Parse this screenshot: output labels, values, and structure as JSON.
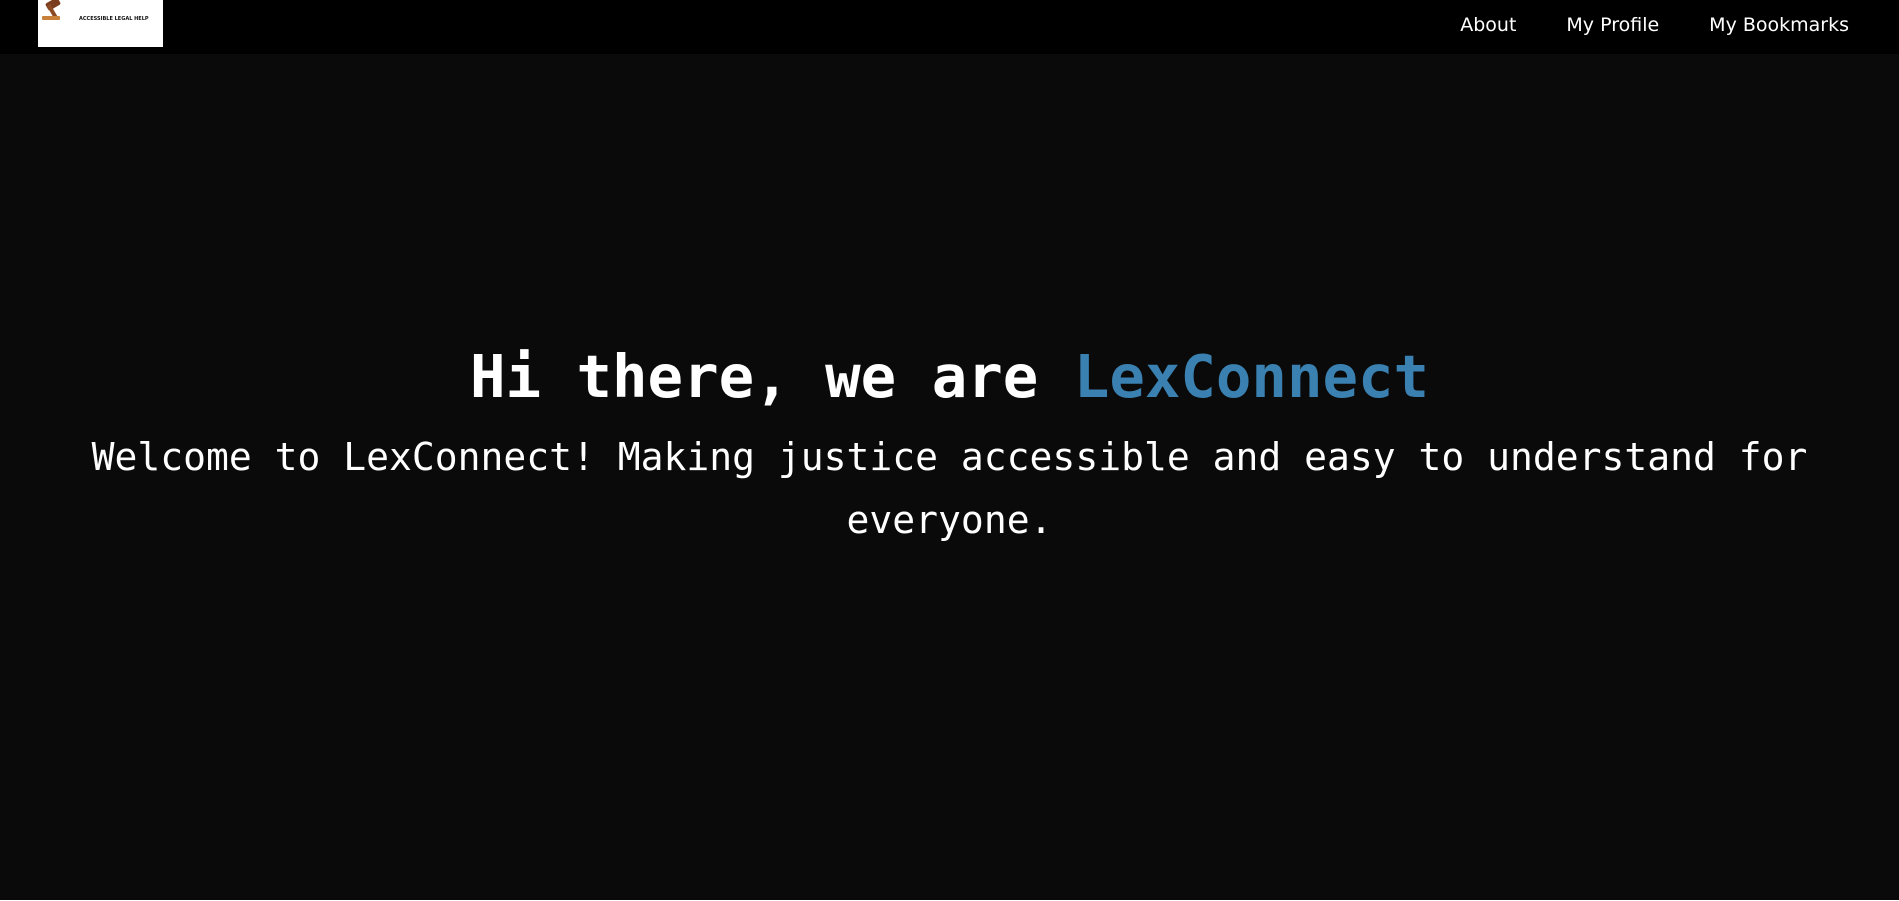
{
  "navbar": {
    "logo": {
      "brand_text": "LexConnect",
      "tagline": "ACCESSIBLE LEGAL HELP"
    },
    "links": [
      "About",
      "My Profile",
      "My Bookmarks"
    ]
  },
  "hero": {
    "title_prefix": "Hi there, we are ",
    "title_brand": "LexConnect",
    "subtitle": "Welcome to LexConnect! Making justice accessible and easy to understand for everyone."
  },
  "colors": {
    "navbar_bg": "#000000",
    "hero_bg": "#0a0a0a",
    "text": "#ffffff",
    "brand_accent": "#3a80b0"
  }
}
